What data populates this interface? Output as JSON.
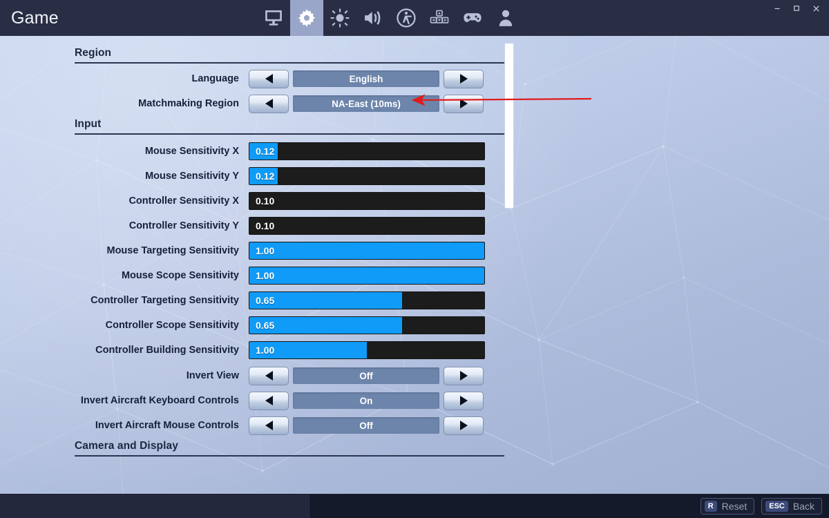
{
  "window": {
    "title": "Game",
    "controls": [
      {
        "name": "minimize",
        "glyph": "minimize-icon"
      },
      {
        "name": "maximize",
        "glyph": "maximize-icon"
      },
      {
        "name": "close",
        "glyph": "close-icon"
      }
    ]
  },
  "tabs": [
    {
      "id": "display",
      "icon": "monitor-icon",
      "active": false
    },
    {
      "id": "game",
      "icon": "gear-icon",
      "active": true
    },
    {
      "id": "brightness",
      "icon": "brightness-icon",
      "active": false
    },
    {
      "id": "audio",
      "icon": "speaker-icon",
      "active": false
    },
    {
      "id": "accessibility",
      "icon": "accessibility-icon",
      "active": false
    },
    {
      "id": "keyboard",
      "icon": "keyboard-controls-icon",
      "active": false
    },
    {
      "id": "controller",
      "icon": "gamepad-icon",
      "active": false
    },
    {
      "id": "account",
      "icon": "person-icon",
      "active": false
    }
  ],
  "sections": [
    {
      "id": "region",
      "title": "Region"
    },
    {
      "id": "input",
      "title": "Input"
    },
    {
      "id": "camera",
      "title": "Camera and Display"
    }
  ],
  "settings": {
    "language": {
      "label": "Language",
      "value": "English",
      "type": "selector"
    },
    "matchmaking_region": {
      "label": "Matchmaking Region",
      "value": "NA-East (10ms)",
      "type": "selector"
    },
    "mouse_sensitivity_x": {
      "label": "Mouse Sensitivity X",
      "value": "0.12",
      "type": "slider",
      "fill_percent": 12
    },
    "mouse_sensitivity_y": {
      "label": "Mouse Sensitivity Y",
      "value": "0.12",
      "type": "slider",
      "fill_percent": 12
    },
    "controller_sensitivity_x": {
      "label": "Controller Sensitivity X",
      "value": "0.10",
      "type": "slider",
      "fill_percent": 0
    },
    "controller_sensitivity_y": {
      "label": "Controller Sensitivity Y",
      "value": "0.10",
      "type": "slider",
      "fill_percent": 0
    },
    "mouse_targeting_sensitivity": {
      "label": "Mouse Targeting Sensitivity",
      "value": "1.00",
      "type": "slider",
      "fill_percent": 100
    },
    "mouse_scope_sensitivity": {
      "label": "Mouse Scope Sensitivity",
      "value": "1.00",
      "type": "slider",
      "fill_percent": 100
    },
    "controller_targeting_sensitivity": {
      "label": "Controller Targeting Sensitivity",
      "value": "0.65",
      "type": "slider",
      "fill_percent": 65
    },
    "controller_scope_sensitivity": {
      "label": "Controller Scope Sensitivity",
      "value": "0.65",
      "type": "slider",
      "fill_percent": 65
    },
    "controller_building_sensitivity": {
      "label": "Controller Building Sensitivity",
      "value": "1.00",
      "type": "slider",
      "fill_percent": 50
    },
    "invert_view": {
      "label": "Invert View",
      "value": "Off",
      "type": "selector"
    },
    "invert_aircraft_keyboard": {
      "label": "Invert Aircraft Keyboard Controls",
      "value": "On",
      "type": "selector"
    },
    "invert_aircraft_mouse": {
      "label": "Invert Aircraft Mouse Controls",
      "value": "Off",
      "type": "selector"
    }
  },
  "footer": {
    "reset": {
      "key": "R",
      "label": "Reset"
    },
    "back": {
      "key": "ESC",
      "label": "Back"
    }
  },
  "annotation": {
    "type": "arrow",
    "color": "#e01b1b",
    "points_to": "matchmaking_region_value"
  },
  "colors": {
    "titlebar": "#2a2e45",
    "tab_active": "#9aa6c9",
    "slider_fill": "#0f9bf7",
    "slider_track": "#1c1c1c",
    "selector_value": "#6d85ab",
    "label_text": "#16203a",
    "footer": "#151a2b"
  }
}
